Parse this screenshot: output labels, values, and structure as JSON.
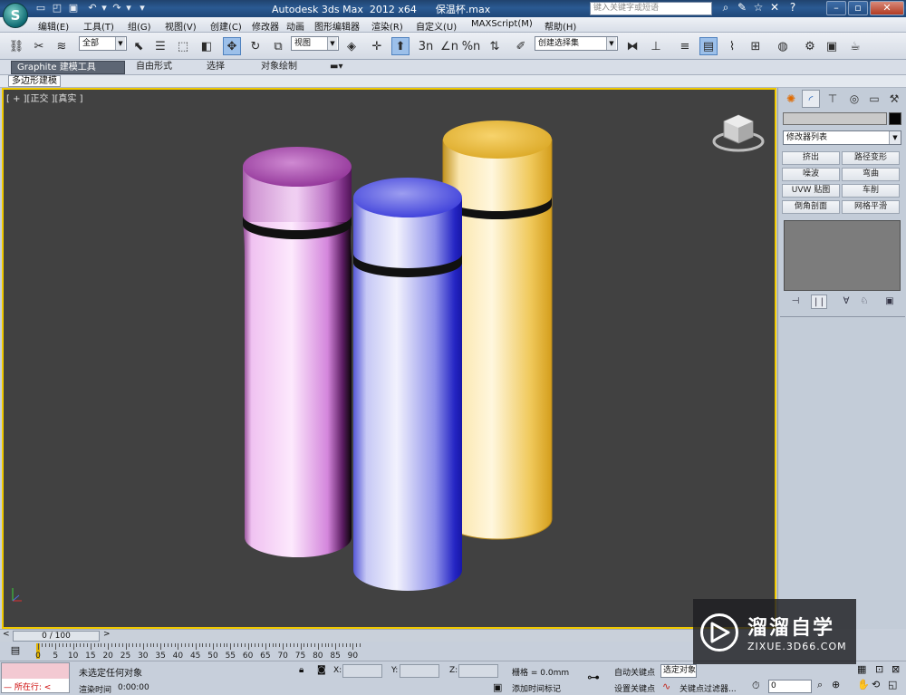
{
  "window": {
    "title": "Autodesk 3ds Max  2012 x64      保温杯.max",
    "search_placeholder": "键入关键字或短语",
    "icon_names": [
      "search-icon",
      "wrench-icon",
      "star-icon",
      "help-icon",
      "minimize-icon",
      "maximize-icon",
      "close-icon"
    ]
  },
  "menu": {
    "items": [
      "编辑(E)",
      "工具(T)",
      "组(G)",
      "视图(V)",
      "创建(C)",
      "修改器",
      "动画",
      "图形编辑器",
      "渲染(R)",
      "自定义(U)",
      "MAXScript(M)",
      "帮助(H)"
    ]
  },
  "toolbar": {
    "selection_filter": "全部",
    "reference_coord": "视图",
    "named_selection": "创建选择集",
    "snap_labels": [
      "3n",
      "∠n",
      "%n"
    ],
    "active_tools": [
      "select-move",
      "select-window"
    ]
  },
  "ribbon": {
    "tabs": [
      "Graphite 建模工具",
      "自由形式",
      "选择",
      "对象绘制"
    ],
    "active_tab": "Graphite 建模工具",
    "sub_panel": "多边形建模"
  },
  "viewport": {
    "label": "[ + ][正交 ][真实 ]",
    "background": "#414141",
    "border_color": "#f0c900",
    "objects": [
      {
        "name": "pink-cup",
        "color": "#d86fd8",
        "band_color": "#111111"
      },
      {
        "name": "blue-cup",
        "color": "#4a4be8",
        "band_color": "#111111"
      },
      {
        "name": "gold-cup",
        "color": "#e6b730",
        "band_color": "#111111"
      }
    ]
  },
  "command_panel": {
    "modifier_list": "修改器列表",
    "buttons": [
      [
        "挤出",
        "路径变形"
      ],
      [
        "噪波",
        "弯曲"
      ],
      [
        "UVW 贴图",
        "车削"
      ],
      [
        "倒角剖面",
        "网格平滑"
      ]
    ]
  },
  "time": {
    "frame_display": "0 / 100",
    "ticks": [
      "0",
      "5",
      "10",
      "15",
      "20",
      "25",
      "30",
      "35",
      "40",
      "45",
      "50",
      "55",
      "60",
      "65",
      "70",
      "75",
      "80",
      "85",
      "90"
    ]
  },
  "status": {
    "listener_prefix": "所在行:",
    "selection_status": "未选定任何对象",
    "render_time_label": "渲染时间",
    "render_time_value": "0:00:00",
    "x_label": "X:",
    "y_label": "Y:",
    "z_label": "Z:",
    "grid": "栅格 = 0.0mm",
    "add_time_tag": "添加时间标记",
    "auto_key": "自动关键点",
    "set_key": "设置关键点",
    "selected_object": "选定对象",
    "key_filters": "关键点过滤器...",
    "frame_field": "0"
  },
  "watermark": {
    "title": "溜溜自学",
    "subtitle": "ZIXUE.3D66.COM"
  }
}
